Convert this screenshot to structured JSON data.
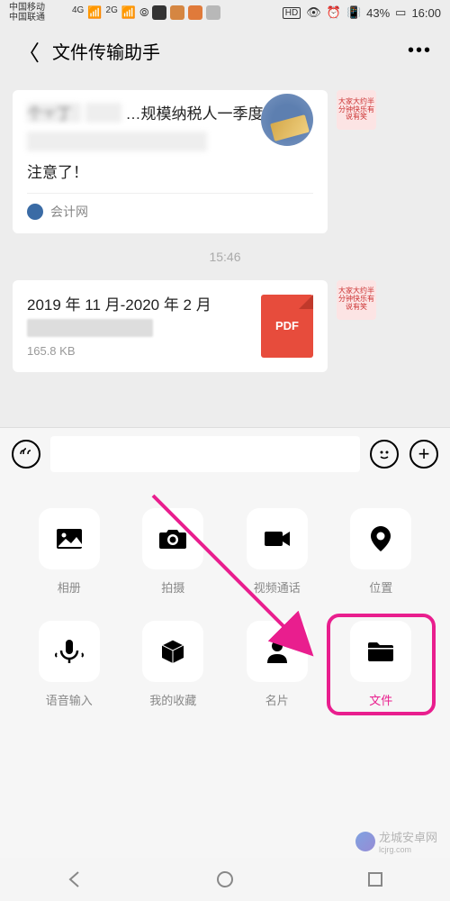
{
  "status": {
    "carrier1": "中国移动",
    "carrier2": "中国联通",
    "net1": "4G",
    "net2": "2G",
    "hd": "HD",
    "battery": "43%",
    "time": "16:00"
  },
  "header": {
    "title": "文件传输助手"
  },
  "messages": {
    "article": {
      "title_blur": "个ㅜ丁",
      "title_mid": "…规模纳税人一季度",
      "line2": "注意了！",
      "source": "会计网"
    },
    "timestamp": "15:46",
    "file": {
      "name": "2019 年 11 月-2020 年 2 月",
      "size": "165.8 KB",
      "type": "PDF"
    },
    "avatar_text": "大家大约半分钟快乐有说有笑"
  },
  "attachments": [
    {
      "key": "album",
      "label": "相册"
    },
    {
      "key": "camera",
      "label": "拍摄"
    },
    {
      "key": "video",
      "label": "视频通话"
    },
    {
      "key": "location",
      "label": "位置"
    },
    {
      "key": "voiceinput",
      "label": "语音输入"
    },
    {
      "key": "favorite",
      "label": "我的收藏"
    },
    {
      "key": "contact",
      "label": "名片"
    },
    {
      "key": "file",
      "label": "文件"
    }
  ],
  "watermark": "龙城安卓网",
  "watermark_url": "lcjrg.com"
}
